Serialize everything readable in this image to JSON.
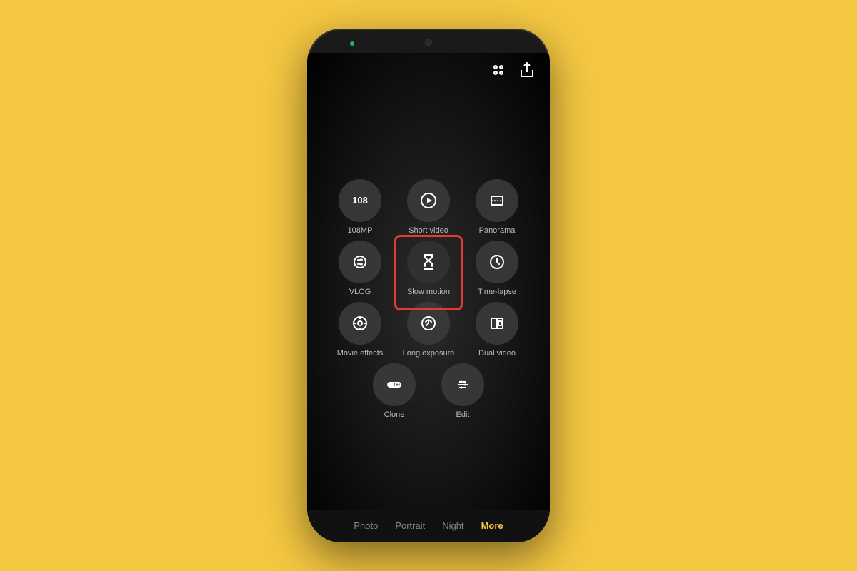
{
  "background_color": "#F5C842",
  "phone": {
    "led_color": "#00C853",
    "screen": {
      "top_icons": {
        "grid_icon": "⠿",
        "share_icon": "↗"
      },
      "modes": [
        [
          {
            "id": "108mp",
            "label": "108MP",
            "icon": "108MP",
            "type": "text"
          },
          {
            "id": "short-video",
            "label": "Short video",
            "icon": "▶",
            "type": "play"
          },
          {
            "id": "panorama",
            "label": "Panorama",
            "icon": "panorama",
            "type": "panorama"
          }
        ],
        [
          {
            "id": "vlog",
            "label": "VLOG",
            "icon": "vlog",
            "type": "vlog"
          },
          {
            "id": "slow-motion",
            "label": "Slow motion",
            "icon": "slow",
            "type": "slow",
            "highlighted": true
          },
          {
            "id": "time-lapse",
            "label": "Time-lapse",
            "icon": "timelapse",
            "type": "timelapse"
          }
        ],
        [
          {
            "id": "movie-effects",
            "label": "Movie effects",
            "icon": "movie",
            "type": "movie"
          },
          {
            "id": "long-exposure",
            "label": "Long exposure",
            "icon": "longexp",
            "type": "longexp"
          },
          {
            "id": "dual-video",
            "label": "Dual video",
            "icon": "dual",
            "type": "dual"
          }
        ],
        [
          {
            "id": "clone",
            "label": "Clone",
            "icon": "clone",
            "type": "clone"
          },
          {
            "id": "edit",
            "label": "Edit",
            "icon": "edit",
            "type": "edit"
          }
        ]
      ],
      "bottom_nav": [
        {
          "id": "photo",
          "label": "Photo",
          "active": false
        },
        {
          "id": "portrait",
          "label": "Portrait",
          "active": false
        },
        {
          "id": "night",
          "label": "Night",
          "active": false
        },
        {
          "id": "more",
          "label": "More",
          "active": true
        }
      ]
    }
  }
}
